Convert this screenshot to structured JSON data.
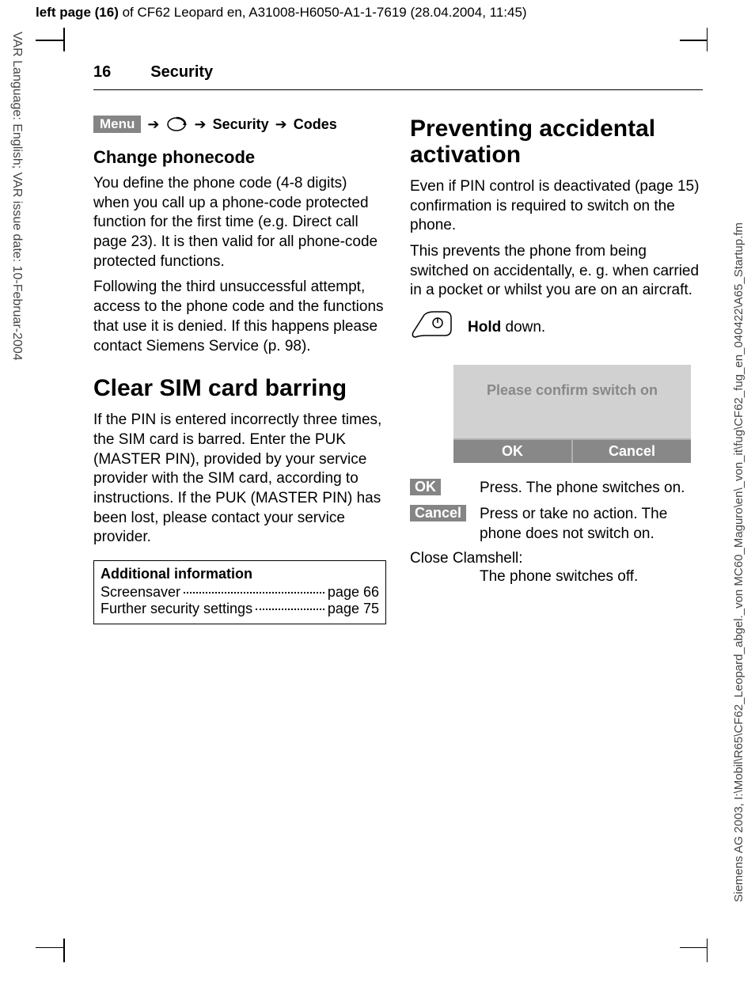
{
  "header": {
    "bold": "left page (16)",
    "rest": " of CF62 Leopard en, A31008-H6050-A1-1-7619 (28.04.2004, 11:45)"
  },
  "leftMargin": "VAR Language: English; VAR issue date: 10-Februar-2004",
  "rightMargin": "Siemens AG 2003, I:\\Mobil\\R65\\CF62_Leopard_abgel._von MC60_Maguro\\en\\_von_it\\fug\\CF62_fug_en_040422\\A65_Startup.fm",
  "pageNumber": "16",
  "sectionTitle": "Security",
  "breadcrumb": {
    "menu": "Menu",
    "security": "Security",
    "codes": "Codes"
  },
  "left": {
    "h2": "Change phonecode",
    "p1": "You define the phone code (4-8 digits) when you call up a phone-code protected function for the first time (e.g. Direct call page 23). It is then valid for all phone-code protected functions.",
    "p2": "Following the third unsuccessful attempt, access to the phone code and the functions that use it is denied. If this happens please contact Siemens Service (p. 98).",
    "h1": "Clear SIM card barring",
    "p3": "If the PIN is entered incorrectly three times, the SIM card is barred. Enter the PUK (MASTER PIN), provided by your service provider with the SIM card, according to instructions. If the PUK (MASTER PIN) has been lost, please contact your service provider.",
    "infoTitle": "Additional information",
    "infoRow1Label": "Screensaver",
    "infoRow1Page": "page 66",
    "infoRow2Label": "Further security settings",
    "infoRow2Page": "page 75"
  },
  "right": {
    "h1": "Preventing accidental activation",
    "p1": "Even if PIN control is deactivated (page 15) confirmation is required to switch on the phone.",
    "p2": "This prevents the phone from being switched on accidentally, e. g. when carried in a pocket or whilst you are on an aircraft.",
    "holdBold": "Hold",
    "holdRest": " down.",
    "dialogText": "Please confirm switch on",
    "ok": "OK",
    "cancel": "Cancel",
    "okDesc": "Press. The phone switches on.",
    "cancelDesc": "Press or take no action. The phone does not switch on.",
    "closeLabel": "Close Clamshell:",
    "closeDesc": "The phone switches off."
  }
}
